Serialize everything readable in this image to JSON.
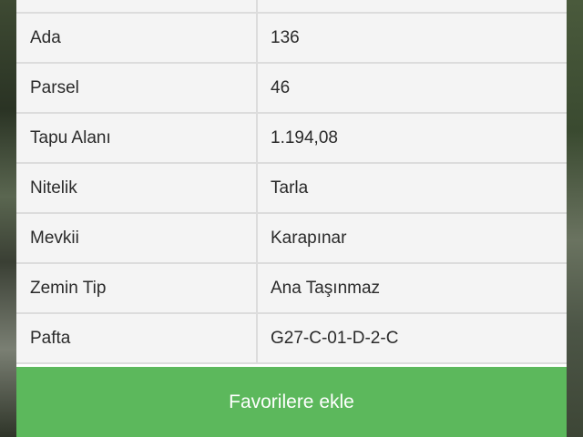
{
  "rows": [
    {
      "label": "",
      "value": ""
    },
    {
      "label": "Ada",
      "value": "136"
    },
    {
      "label": "Parsel",
      "value": "46"
    },
    {
      "label": "Tapu Alanı",
      "value": "1.194,08"
    },
    {
      "label": "Nitelik",
      "value": "Tarla"
    },
    {
      "label": "Mevkii",
      "value": "Karapınar"
    },
    {
      "label": "Zemin Tip",
      "value": "Ana Taşınmaz"
    },
    {
      "label": "Pafta",
      "value": "G27-C-01-D-2-C"
    }
  ],
  "favorite_button": {
    "label": "Favorilere ekle",
    "color": "#5cb85c"
  }
}
